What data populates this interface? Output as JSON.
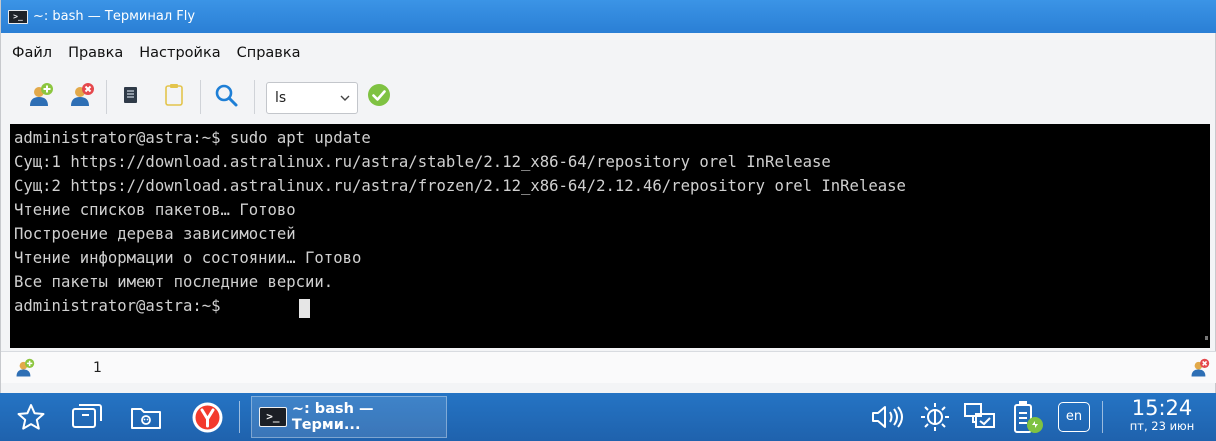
{
  "window": {
    "title": "~: bash — Терминал Fly",
    "title_icon": "terminal-icon"
  },
  "menu": {
    "items": [
      "Файл",
      "Правка",
      "Настройка",
      "Справка"
    ]
  },
  "toolbar": {
    "icons": [
      "new-session-icon",
      "close-session-icon",
      "copy-icon",
      "paste-icon",
      "search-icon",
      "run-command-icon"
    ],
    "command_select_value": "ls"
  },
  "terminal": {
    "lines": [
      "administrator@astra:~$ sudo apt update",
      "Сущ:1 https://download.astralinux.ru/astra/stable/2.12_x86-64/repository orel InRelease",
      "Сущ:2 https://download.astralinux.ru/astra/frozen/2.12_x86-64/2.12.46/repository orel InRelease",
      "Чтение списков пакетов… Готово",
      "Построение дерева зависимостей",
      "Чтение информации о состоянии… Готово",
      "Все пакеты имеют последние версии.",
      "administrator@astra:~$ "
    ],
    "background": "#000000",
    "foreground": "#d0d0d0"
  },
  "tabs": {
    "current": "1"
  },
  "taskbar": {
    "launchers": [
      "start-menu-icon",
      "desktops-icon",
      "file-manager-icon",
      "yandex-browser-icon"
    ],
    "task_label": "~: bash — Терми...",
    "tray_icons": [
      "volume-icon",
      "brightness-icon",
      "network-icon",
      "battery-icon"
    ],
    "language": "en",
    "clock_time": "15:24",
    "clock_date": "пт, 23 июн"
  },
  "colors": {
    "titlebar": "#2a7fd5",
    "taskbar": "#1f62ad",
    "accent_green": "#7fc242"
  }
}
